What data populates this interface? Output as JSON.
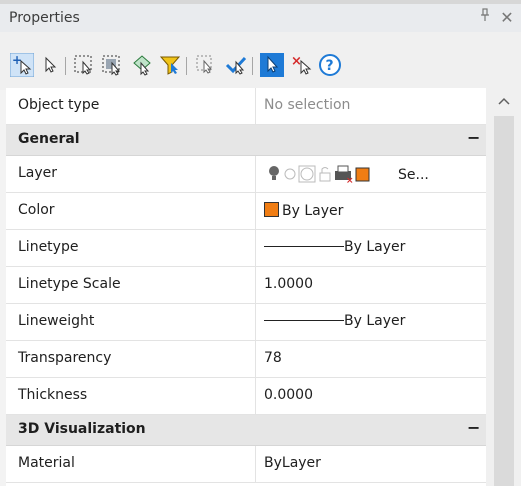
{
  "window": {
    "title": "Properties"
  },
  "titlebar_icons": [
    "pin-icon",
    "close-icon"
  ],
  "toolbar": {
    "buttons": [
      "add-selection-icon",
      "select-objects-icon",
      "quick-select-icon",
      "select-similar-icon",
      "toggle-pickadd-icon",
      "filter-icon",
      "object-list-icon",
      "deselect-icon",
      "pickadd-toggle-icon",
      "clear-selection-icon",
      "help-icon"
    ]
  },
  "properties": {
    "object_type": {
      "label": "Object type",
      "value": "No selection"
    },
    "general": {
      "header": "General",
      "collapse": "−",
      "layer": {
        "label": "Layer",
        "value": "Se..."
      },
      "color": {
        "label": "Color",
        "value": "By Layer"
      },
      "linetype": {
        "label": "Linetype",
        "value": "By Layer"
      },
      "linetype_scale": {
        "label": "Linetype Scale",
        "value": "1.0000"
      },
      "lineweight": {
        "label": "Lineweight",
        "value": "By Layer"
      },
      "transparency": {
        "label": "Transparency",
        "value": "78"
      },
      "thickness": {
        "label": "Thickness",
        "value": "0.0000"
      }
    },
    "visualization_3d": {
      "header": "3D Visualization",
      "collapse": "−",
      "material": {
        "label": "Material",
        "value": "ByLayer"
      }
    }
  },
  "colors": {
    "swatch": "#f07d13",
    "selected_button": "#1e7ad6",
    "category_bg": "#e6e6e6"
  },
  "scrollbar": {
    "up_arrow": "^"
  }
}
